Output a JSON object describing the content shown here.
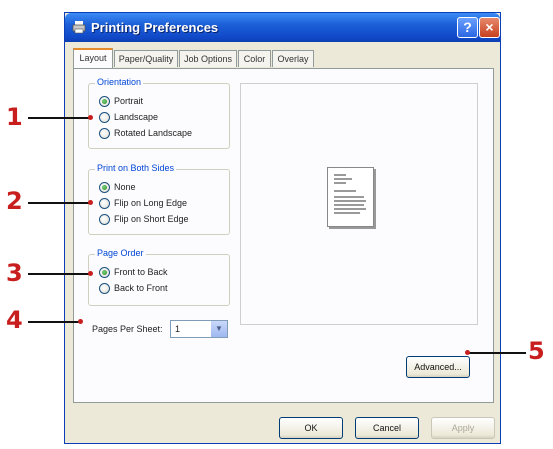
{
  "window": {
    "title": "Printing Preferences",
    "help_label": "?",
    "close_label": "×"
  },
  "tabs": [
    {
      "label": "Layout",
      "active": true
    },
    {
      "label": "Paper/Quality",
      "active": false
    },
    {
      "label": "Job Options",
      "active": false
    },
    {
      "label": "Color",
      "active": false
    },
    {
      "label": "Overlay",
      "active": false
    }
  ],
  "orientation": {
    "legend": "Orientation",
    "options": [
      {
        "label": "Portrait",
        "checked": true
      },
      {
        "label": "Landscape",
        "checked": false
      },
      {
        "label": "Rotated Landscape",
        "checked": false
      }
    ]
  },
  "both_sides": {
    "legend": "Print on Both Sides",
    "options": [
      {
        "label": "None",
        "checked": true
      },
      {
        "label": "Flip on Long Edge",
        "checked": false
      },
      {
        "label": "Flip on Short Edge",
        "checked": false
      }
    ]
  },
  "page_order": {
    "legend": "Page Order",
    "options": [
      {
        "label": "Front to Back",
        "checked": true
      },
      {
        "label": "Back to Front",
        "checked": false
      }
    ]
  },
  "pages_per_sheet": {
    "label": "Pages Per Sheet:",
    "value": "1"
  },
  "buttons": {
    "advanced": "Advanced...",
    "ok": "OK",
    "cancel": "Cancel",
    "apply": "Apply"
  },
  "callouts": [
    "1",
    "2",
    "3",
    "4",
    "5"
  ],
  "colors": {
    "callout": "#c81e1e",
    "titlebar": "#1c5fd8",
    "dialog_bg": "#ece9d8"
  }
}
